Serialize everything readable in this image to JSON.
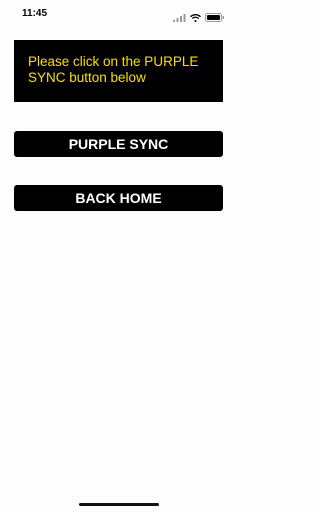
{
  "status_bar": {
    "time": "11:45",
    "icons": [
      "signal-icon",
      "wifi-icon",
      "battery-icon"
    ]
  },
  "instruction": {
    "text": "Please click on the PURPLE SYNC button below",
    "text_color": "#f5e000",
    "background": "#000000"
  },
  "buttons": {
    "purple_sync_label": "PURPLE SYNC",
    "back_home_label": "BACK HOME"
  }
}
